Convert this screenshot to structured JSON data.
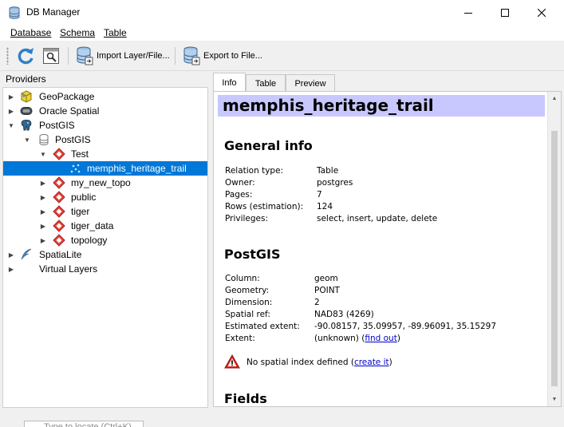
{
  "window": {
    "title": "DB Manager"
  },
  "menu": {
    "database": "Database",
    "schema": "Schema",
    "table": "Table"
  },
  "toolbar": {
    "import_label": "Import Layer/File...",
    "export_label": "Export to File..."
  },
  "providers": {
    "header": "Providers",
    "items": {
      "geopackage": "GeoPackage",
      "oracle": "Oracle Spatial",
      "postgis": "PostGIS",
      "postgis_conn": "PostGIS",
      "test": "Test",
      "trail": "memphis_heritage_trail",
      "my_new_topo": "my_new_topo",
      "public": "public",
      "tiger": "tiger",
      "tiger_data": "tiger_data",
      "topology": "topology",
      "spatialite": "SpatiaLite",
      "virtual": "Virtual Layers"
    }
  },
  "tabs": {
    "info": "Info",
    "table": "Table",
    "preview": "Preview"
  },
  "info": {
    "table_name": "memphis_heritage_trail",
    "general": {
      "heading": "General info",
      "rows": [
        {
          "label": "Relation type:",
          "value": "Table"
        },
        {
          "label": "Owner:",
          "value": "postgres"
        },
        {
          "label": "Pages:",
          "value": "7"
        },
        {
          "label": "Rows (estimation):",
          "value": "124"
        },
        {
          "label": "Privileges:",
          "value": "select, insert, update, delete"
        }
      ]
    },
    "postgis": {
      "heading": "PostGIS",
      "rows": [
        {
          "label": "Column:",
          "value": "geom"
        },
        {
          "label": "Geometry:",
          "value": "POINT"
        },
        {
          "label": "Dimension:",
          "value": "2"
        },
        {
          "label": "Spatial ref:",
          "value": "NAD83 (4269)"
        },
        {
          "label": "Estimated extent:",
          "value": "-90.08157, 35.09957, -89.96091, 35.15297"
        }
      ],
      "extent_label": "Extent:",
      "extent_value": "(unknown) (",
      "extent_link": "find out",
      "extent_close": ")",
      "warning_text": "No spatial index defined (",
      "warning_link": "create it",
      "warning_close": ")"
    },
    "fields_heading": "Fields"
  },
  "statusbar": {
    "locator_placeholder": "Type to locate (Ctrl+K)"
  }
}
